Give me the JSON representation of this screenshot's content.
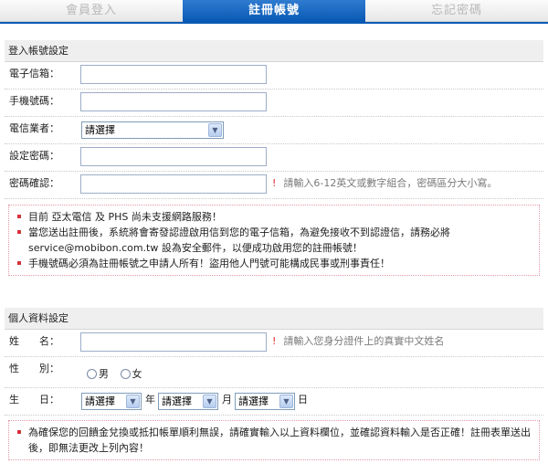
{
  "tabs": [
    {
      "label": "會員登入",
      "active": false
    },
    {
      "label": "註冊帳號",
      "active": true
    },
    {
      "label": "忘記密碼",
      "active": false
    }
  ],
  "login_section": {
    "title": "登入帳號設定",
    "email_label": "電子信箱：",
    "phone_label": "手機號碼：",
    "carrier_label": "電信業者：",
    "carrier_value": "請選擇",
    "password_label": "設定密碼：",
    "confirm_label": "密碼確認：",
    "confirm_hint": "請輸入6-12英文或數字組合，密碼區分大小寫。"
  },
  "notice1": [
    "目前 亞太電信 及 PHS 尚未支援網路服務！",
    "當您送出註冊後，系統將會寄發認證啟用信到您的電子信箱，為避免接收不到認證信，請務必將 service@mobibon.com.tw 設為安全郵件，以便成功啟用您的註冊帳號！",
    "手機號碼必須為註冊帳號之申請人所有！盜用他人門號可能構成民事或刑事責任！"
  ],
  "personal_section": {
    "title": "個人資料設定",
    "name_label": "姓　　名：",
    "name_hint": "請輸入您身分證件上的真實中文姓名",
    "gender_label": "性　　別：",
    "male": "男",
    "female": "女",
    "birthday_label": "生　　日：",
    "year_value": "請選擇",
    "year_unit": "年",
    "month_value": "請選擇",
    "month_unit": "月",
    "day_value": "請選擇",
    "day_unit": "日"
  },
  "notice2": [
    "為確保您的回饋金兌換或抵扣帳單順利無誤，請確實輸入以上資料欄位，並確認資料輸入是否正確！註冊表單送出後，即無法更改上列內容！"
  ],
  "colors": {
    "tab_active": "#0a5ab5",
    "required_mark": "#e0262c",
    "notice_bullet": "#d4323c",
    "notice_border": "#e39aa6"
  }
}
